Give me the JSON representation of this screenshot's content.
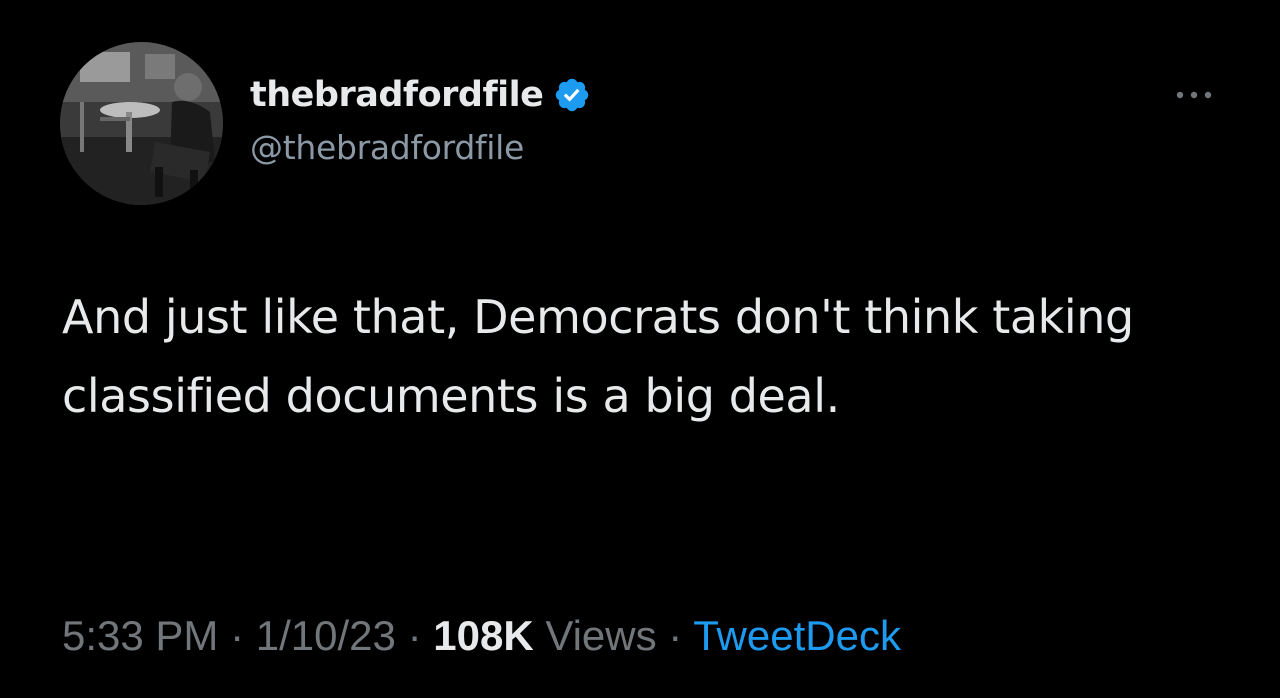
{
  "author": {
    "display_name": "thebradfordfile",
    "handle": "@thebradfordfile",
    "verified": true,
    "verified_color": "#1d9bf0"
  },
  "tweet": {
    "text": "And just like that, Democrats don't think taking classified documents is a big deal."
  },
  "meta": {
    "time": "5:33 PM",
    "date": "1/10/23",
    "separator": "·",
    "views_count": "108K",
    "views_label": "Views",
    "source": "TweetDeck"
  },
  "icons": {
    "more": "more-icon",
    "verified": "verified-badge-icon"
  },
  "colors": {
    "background": "#000000",
    "text": "#e7e9ea",
    "secondary": "#71767b",
    "accent": "#1d9bf0"
  }
}
